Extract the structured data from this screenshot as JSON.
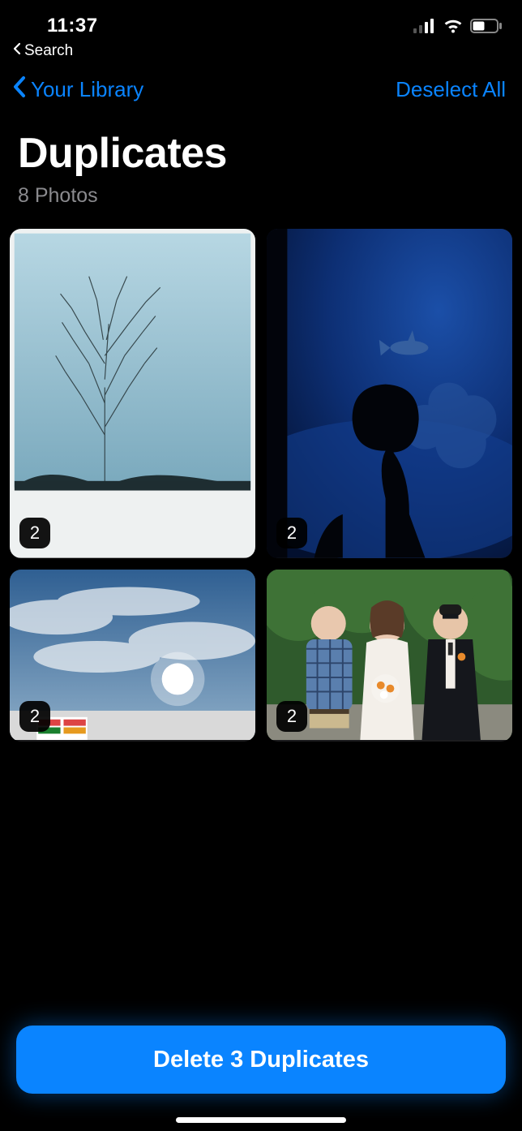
{
  "status": {
    "time": "11:37",
    "breadcrumb": "Search"
  },
  "nav": {
    "back_label": "Your Library",
    "right_action": "Deselect All"
  },
  "title": {
    "heading": "Duplicates",
    "subtitle": "8 Photos"
  },
  "tiles": [
    {
      "badge": "2"
    },
    {
      "badge": "2"
    },
    {
      "badge": "2"
    },
    {
      "badge": "2"
    }
  ],
  "cta": {
    "label": "Delete 3 Duplicates"
  },
  "colors": {
    "accent": "#0a84ff"
  }
}
